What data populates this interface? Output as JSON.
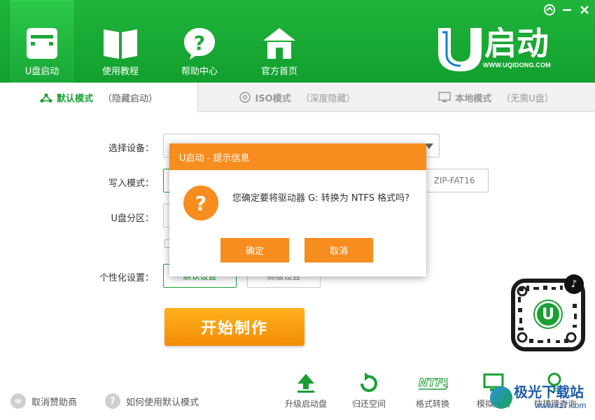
{
  "header": {
    "nav": [
      {
        "label": "U盘启动",
        "icon": "usb-window-icon",
        "active": true
      },
      {
        "label": "使用教程",
        "icon": "book-icon",
        "active": false
      },
      {
        "label": "帮助中心",
        "icon": "help-bubble-icon",
        "active": false
      },
      {
        "label": "官方首页",
        "icon": "home-icon",
        "active": false
      }
    ],
    "logo_text": "启动",
    "logo_letter": "U",
    "logo_domain": "WWW.UQIDONG.COM"
  },
  "tabs": [
    {
      "mode": "默认模式",
      "sub": "（隐藏启动）",
      "active": true,
      "icon": "share-nodes-icon"
    },
    {
      "mode": "ISO模式",
      "sub": "（深度隐藏）",
      "active": false,
      "icon": "disc-icon"
    },
    {
      "mode": "本地模式",
      "sub": "（无需U盘）",
      "active": false,
      "icon": "monitor-icon"
    }
  ],
  "form": {
    "device_label": "选择设备：",
    "write_mode_label": "写入模式：",
    "write_mode_option": "ZIP-FAT16",
    "partition_label": "U盘分区：",
    "personalize_label": "个性化设置：",
    "default_setting": "默认设置",
    "advanced_setting": "高级设置",
    "start_button": "开始制作"
  },
  "bottom": {
    "cancel_sponsor": "取消赞助商",
    "how_to_use": "如何使用默认模式",
    "tools": [
      {
        "label": "升级启动盘",
        "icon": "upload-arrow-icon"
      },
      {
        "label": "归还空间",
        "icon": "refresh-icon"
      },
      {
        "label": "格式转换",
        "icon": "ntfs-icon"
      },
      {
        "label": "模拟启动",
        "icon": "monitor-icon"
      },
      {
        "label": "快捷键查询",
        "icon": "search-icon"
      }
    ],
    "ntfs_text": "NTFS"
  },
  "qr": {
    "letter": "U"
  },
  "watermark": {
    "text": "极光下载站",
    "url": "www.xz7.com"
  },
  "dialog": {
    "title": "U启动 - 提示信息",
    "message": "您确定要将驱动器 G: 转换为 NTFS 格式吗?",
    "confirm": "确定",
    "cancel": "取消",
    "icon_glyph": "?"
  },
  "colors": {
    "green": "#1a9f34",
    "orange": "#f78d1f",
    "start": "#f28b06"
  }
}
